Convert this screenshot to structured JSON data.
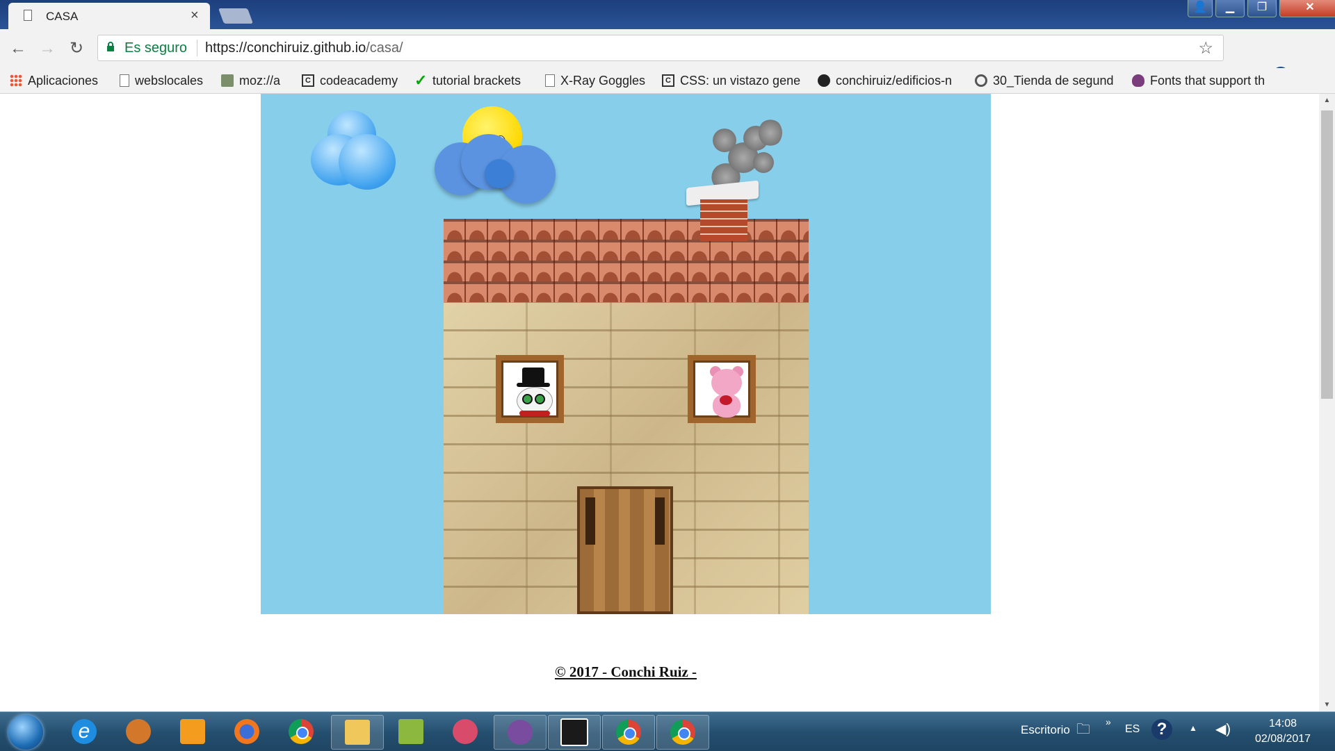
{
  "browser": {
    "tab_title": "CASA",
    "tab_close": "×",
    "window_controls": {
      "user": "👤",
      "minimize": "▁",
      "maximize": "❐",
      "close": "✕"
    },
    "nav": {
      "back": "←",
      "forward": "→",
      "reload": "↻"
    },
    "security_label": "Es seguro",
    "url_host": "https://conchiruiz.github.io",
    "url_path": "/casa/",
    "star": "☆",
    "menu": "⋮",
    "bookmarks": [
      {
        "label": "Aplicaciones",
        "icon": "apps-grid-icon"
      },
      {
        "label": "webslocales",
        "icon": "page-icon"
      },
      {
        "label": "moz://a",
        "icon": "moz-icon"
      },
      {
        "label": "codeacademy",
        "icon": "codecademy-icon"
      },
      {
        "label": "tutorial brackets",
        "icon": "checkmark-icon"
      },
      {
        "label": "X-Ray Goggles",
        "icon": "page-icon"
      },
      {
        "label": "CSS: un vistazo gener",
        "icon": "codecademy-icon"
      },
      {
        "label": "conchiruiz/edificios-n",
        "icon": "github-icon"
      },
      {
        "label": "30_Tienda de segund",
        "icon": "circle-g-icon"
      },
      {
        "label": "Fonts that support th",
        "icon": "bulb-icon"
      }
    ]
  },
  "page": {
    "footer": "© 2017 - Conchi Ruiz -"
  },
  "taskbar": {
    "tray_label": "Escritorio",
    "language": "ES",
    "time": "14:08",
    "date": "02/08/2017"
  },
  "colors": {
    "sky": "#87ceeb",
    "secure_green": "#0b8043",
    "taskbar": "#244e6e"
  }
}
